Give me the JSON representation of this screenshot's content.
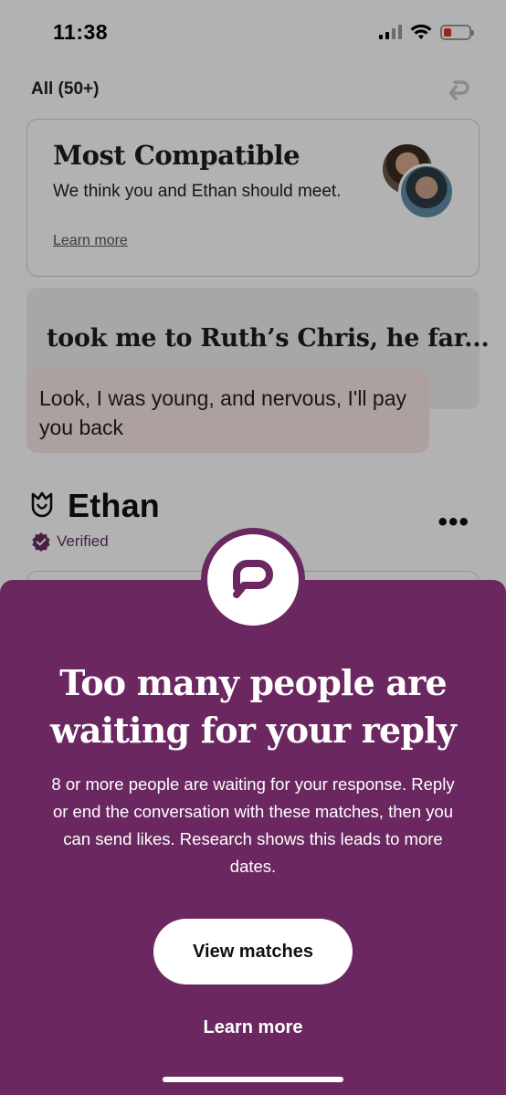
{
  "status_bar": {
    "time": "11:38",
    "icons": [
      "cellular-signal-icon",
      "wifi-icon",
      "battery-low-icon"
    ],
    "battery_color": "#e0312d"
  },
  "header": {
    "filter_label": "All (50+)",
    "undo_icon": "undo-icon"
  },
  "compatible_card": {
    "title": "Most Compatible",
    "body": "We think you and Ethan should meet.",
    "link": "Learn more"
  },
  "prompt_card": {
    "prompt_text": "took me to Ruth’s Chris, he far...",
    "reply_text": "Look, I was young, and nervous, I'll pay you back"
  },
  "profile": {
    "name": "Ethan",
    "verified_label": "Verified",
    "menu_icon": "more-dots-icon"
  },
  "sheet": {
    "title": "Too many people are waiting for your reply",
    "body": "8 or more people are waiting for your response. Reply or end the conversation with these matches, then you can send likes. Research shows this leads to more dates.",
    "primary_button": "View matches",
    "secondary_link": "Learn more",
    "background_color": "#6b2860"
  }
}
